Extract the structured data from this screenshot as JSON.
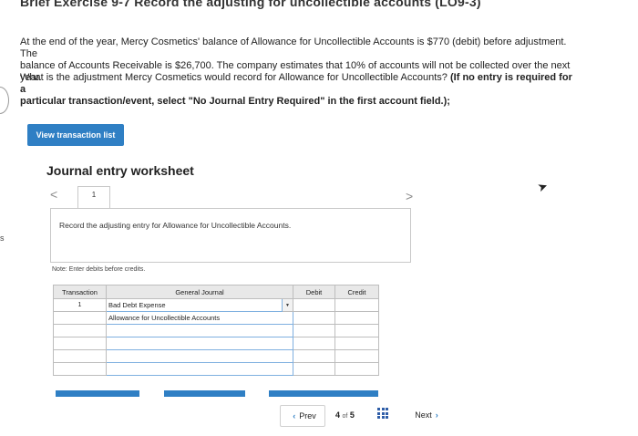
{
  "header": {
    "title": "Brief Exercise 9-7 Record the adjusting for uncollectible accounts (LO9-3)"
  },
  "problem": {
    "line1": "At the end of the year, Mercy Cosmetics' balance of Allowance for Uncollectible Accounts is $770 (debit) before adjustment. The",
    "line2": "balance of Accounts Receivable is $26,700. The company estimates that 10% of accounts will not be collected over the next year.",
    "question": "What is the adjustment Mercy Cosmetics would record for Allowance for Uncollectible Accounts?",
    "instruction_line1": "(If no entry is required for a",
    "instruction_line2": "particular transaction/event, select \"No Journal Entry Required\" in the first account field.);"
  },
  "edge_label": "s",
  "view_button": "View transaction list",
  "worksheet": {
    "title": "Journal entry worksheet",
    "prev_arrow": "<",
    "next_arrow": ">",
    "tab_number": "1",
    "task": "Record the adjusting entry for Allowance for Uncollectible Accounts.",
    "note": "Note: Enter debits before credits."
  },
  "journal": {
    "headers": {
      "transaction": "Transaction",
      "general_journal": "General Journal",
      "debit": "Debit",
      "credit": "Credit"
    },
    "rows": [
      {
        "transaction": "1",
        "account": "Bad Debt Expense",
        "debit": "",
        "credit": ""
      },
      {
        "transaction": "",
        "account": "Allowance for Uncollectible Accounts",
        "debit": "",
        "credit": ""
      },
      {
        "transaction": "",
        "account": "",
        "debit": "",
        "credit": ""
      },
      {
        "transaction": "",
        "account": "",
        "debit": "",
        "credit": ""
      },
      {
        "transaction": "",
        "account": "",
        "debit": "",
        "credit": ""
      },
      {
        "transaction": "",
        "account": "",
        "debit": "",
        "credit": ""
      }
    ],
    "dropdown_glyph": "▼"
  },
  "pagination": {
    "prev": "Prev",
    "current": "4",
    "of": "of",
    "total": "5",
    "next": "Next"
  },
  "icons": {
    "prev_chevron": "‹",
    "next_chevron": "›",
    "cursor": "➤"
  },
  "colors": {
    "primary_button": "#2f7fc4",
    "table_header": "#e8e8e8",
    "focus_outline": "#7fb0e0"
  }
}
